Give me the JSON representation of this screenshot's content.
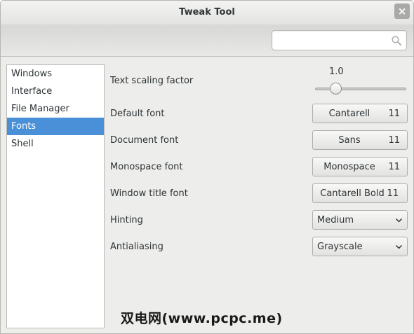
{
  "window": {
    "title": "Tweak Tool",
    "close_glyph": "×"
  },
  "search": {
    "value": "",
    "placeholder": "",
    "icon": "search-icon"
  },
  "sidebar": {
    "items": [
      {
        "label": "Windows",
        "selected": false
      },
      {
        "label": "Interface",
        "selected": false
      },
      {
        "label": "File Manager",
        "selected": false
      },
      {
        "label": "Fonts",
        "selected": true
      },
      {
        "label": "Shell",
        "selected": false
      }
    ]
  },
  "fonts": {
    "text_scaling": {
      "label": "Text scaling factor",
      "value": "1.0"
    },
    "default_font": {
      "label": "Default font",
      "name": "Cantarell",
      "size": "11"
    },
    "document_font": {
      "label": "Document font",
      "name": "Sans",
      "size": "11"
    },
    "monospace_font": {
      "label": "Monospace font",
      "name": "Monospace",
      "size": "11"
    },
    "window_title_font": {
      "label": "Window title font",
      "name": "Cantarell Bold",
      "size": "11"
    },
    "hinting": {
      "label": "Hinting",
      "value": "Medium"
    },
    "antialiasing": {
      "label": "Antialiasing",
      "value": "Grayscale"
    }
  },
  "watermark": "双电网(www.pcpc.me)",
  "colors": {
    "selection": "#4a90d9",
    "window_bg": "#ededeb"
  }
}
